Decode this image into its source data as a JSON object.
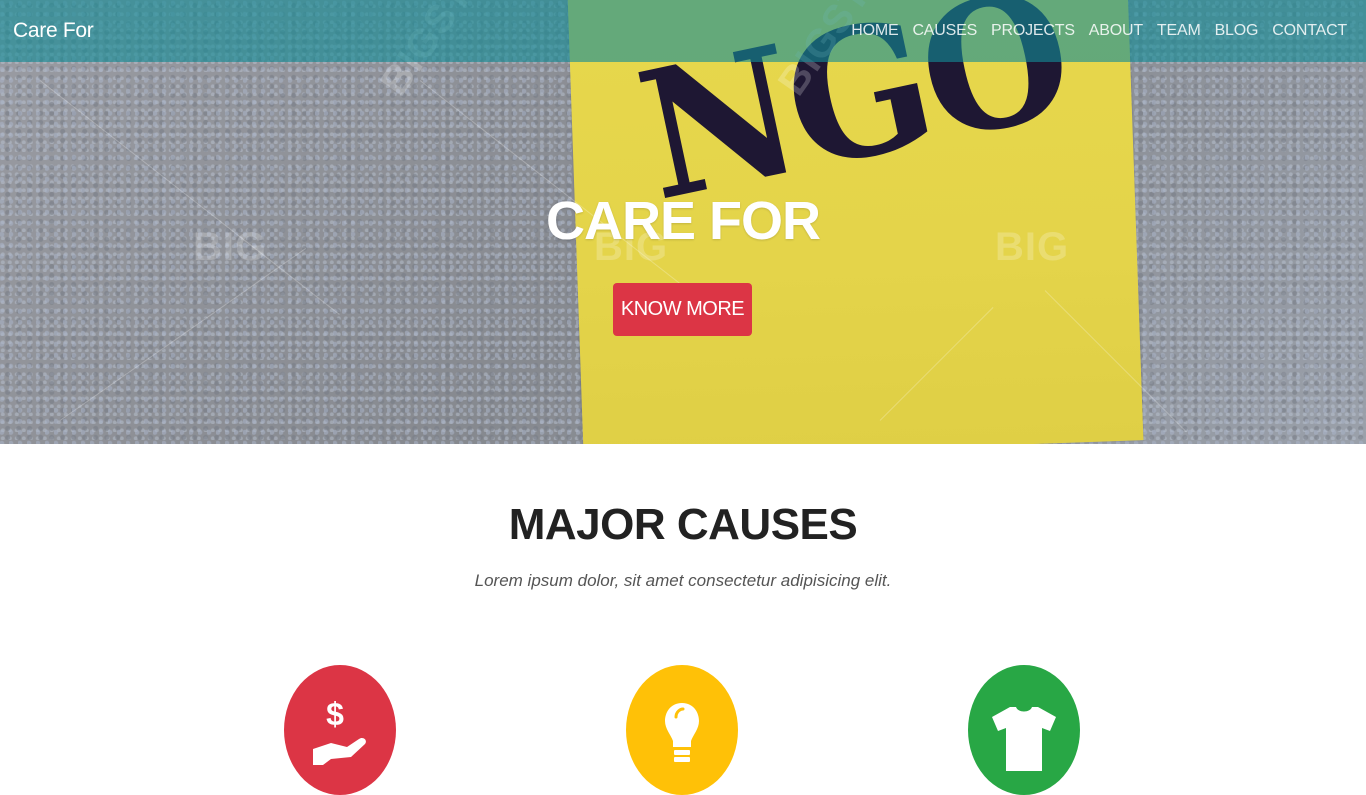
{
  "navbar": {
    "brand": "Care For",
    "links": [
      "HOME",
      "CAUSES",
      "PROJECTS",
      "ABOUT",
      "TEAM",
      "BLOG",
      "CONTACT"
    ]
  },
  "hero": {
    "sign_text": "NGO",
    "title": "CARE FOR",
    "button_label": "KNOW MORE",
    "watermarks": [
      "BIG",
      "BIG",
      "BIG",
      "BIGST",
      "BIGST"
    ]
  },
  "causes": {
    "title": "MAJOR CAUSES",
    "subtitle": "Lorem ipsum dolor, sit amet consectetur adipisicing elit.",
    "items": [
      {
        "icon": "donation-icon",
        "color": "#dc3545"
      },
      {
        "icon": "lightbulb-icon",
        "color": "#ffc107"
      },
      {
        "icon": "tshirt-icon",
        "color": "#28a745"
      }
    ]
  },
  "colors": {
    "navbar": "#148c96",
    "accent_red": "#dc3545",
    "accent_yellow": "#ffc107",
    "accent_green": "#28a745"
  }
}
